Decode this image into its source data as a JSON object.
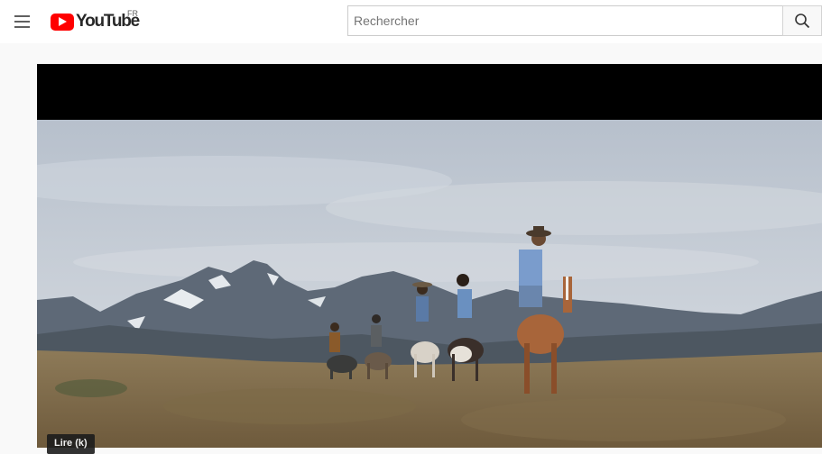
{
  "masthead": {
    "menu_icon": "hamburger-menu-icon",
    "logo_text": "YouTube",
    "country_code": "FR",
    "logo_color": "#ff0000"
  },
  "search": {
    "placeholder": "Rechercher",
    "value": "",
    "button_icon": "search-icon"
  },
  "player": {
    "tooltip": "Lire (k)"
  }
}
